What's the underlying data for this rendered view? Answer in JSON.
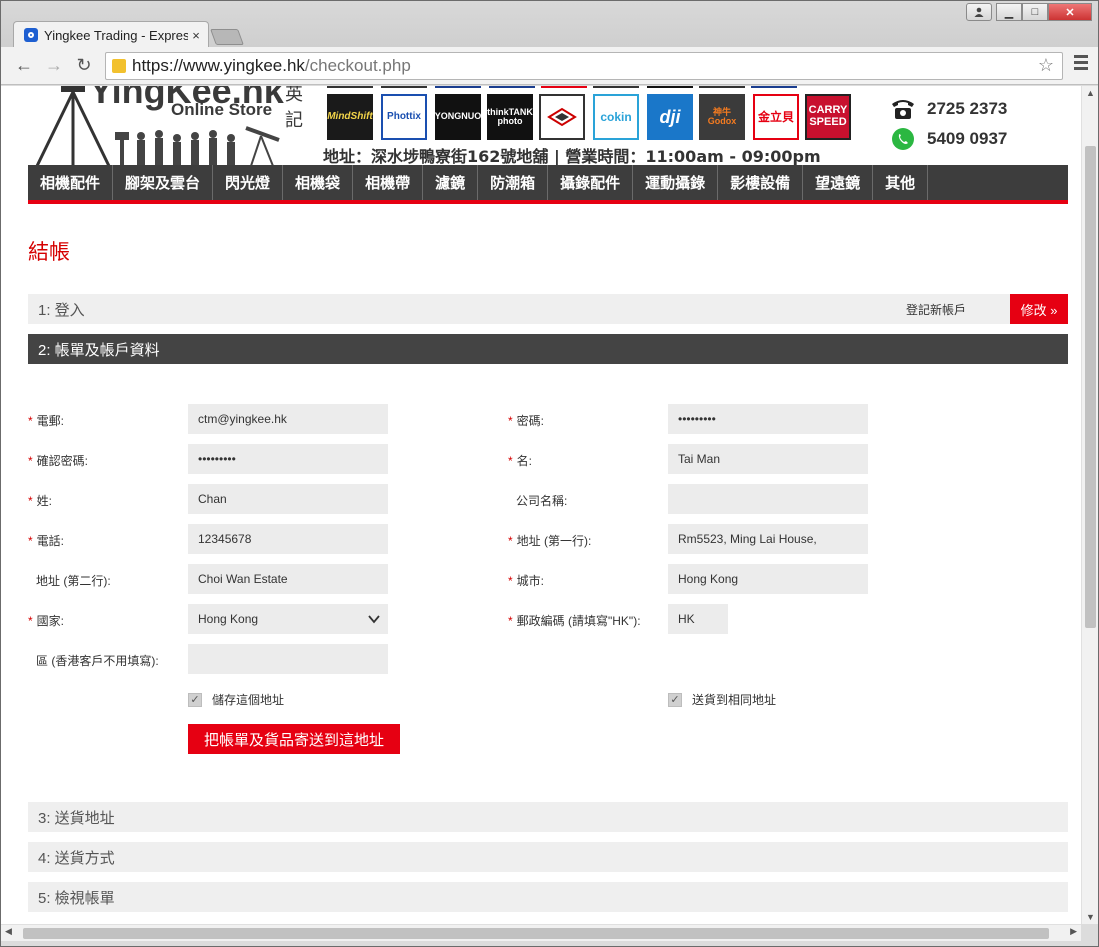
{
  "browser": {
    "tab_title": "Yingkee Trading - Expres",
    "tab_close": "×",
    "url_host": "https://www.yingkee.hk",
    "url_path": "/checkout.php",
    "icons": {
      "back": "←",
      "forward": "→",
      "reload": "↻",
      "star": "☆",
      "minimize": "▁",
      "maximize": "□",
      "close": "✕"
    }
  },
  "header": {
    "brand": "YingKee.hk",
    "brand_sub": "Online Store",
    "brand_cjk": "英記",
    "brand_logos": [
      "MindShift",
      "Phottix",
      "YONGNUO",
      "thinkTANK photo",
      "",
      "cokin",
      "dji",
      "神牛 Godox",
      "金立貝",
      "CARRY SPEED"
    ],
    "shop_info": "地址：深水埗鴨寮街162號地舖  |  營業時間：11:00am - 09:00pm",
    "phone": "2725 2373",
    "whatsapp": "5409 0937",
    "nav": [
      "相機配件",
      "腳架及雲台",
      "閃光燈",
      "相機袋",
      "相機帶",
      "濾鏡",
      "防潮箱",
      "攝錄配件",
      "運動攝錄",
      "影樓設備",
      "望遠鏡",
      "其他"
    ]
  },
  "page": {
    "title": "結帳",
    "step1": {
      "label": "1: 登入",
      "register": "登記新帳戶",
      "edit": "修改 »"
    },
    "step2": {
      "label": "2: 帳單及帳戶資料"
    },
    "step3": {
      "label": "3: 送貨地址"
    },
    "step4": {
      "label": "4: 送貨方式"
    },
    "step5": {
      "label": "5: 檢視帳單"
    }
  },
  "form": {
    "email": {
      "label": "電郵:",
      "value": "ctm@yingkee.hk"
    },
    "password": {
      "label": "密碼:",
      "value": "•••••••••"
    },
    "confirm_password": {
      "label": "確認密碼:",
      "value": "•••••••••"
    },
    "first_name": {
      "label": "名:",
      "value": "Tai Man"
    },
    "last_name": {
      "label": "姓:",
      "value": "Chan"
    },
    "company": {
      "label": "公司名稱:",
      "value": ""
    },
    "phone": {
      "label": "電話:",
      "value": "12345678"
    },
    "address1": {
      "label": "地址 (第一行):",
      "value": "Rm5523, Ming Lai House,"
    },
    "address2": {
      "label": "地址 (第二行):",
      "value": "Choi Wan Estate"
    },
    "city": {
      "label": "城市:",
      "value": "Hong Kong"
    },
    "country": {
      "label": "國家:",
      "value": "Hong Kong"
    },
    "postcode": {
      "label": "郵政編碼 (請填寫\"HK\"):",
      "value": "HK"
    },
    "district": {
      "label": "區 (香港客戶不用填寫):",
      "value": ""
    },
    "save_address": {
      "label": "儲存這個地址",
      "checked": true
    },
    "same_shipping": {
      "label": "送貨到相同地址",
      "checked": true
    },
    "submit": "把帳單及貨品寄送到這地址",
    "required_mark": "*",
    "check_mark": "✓"
  }
}
